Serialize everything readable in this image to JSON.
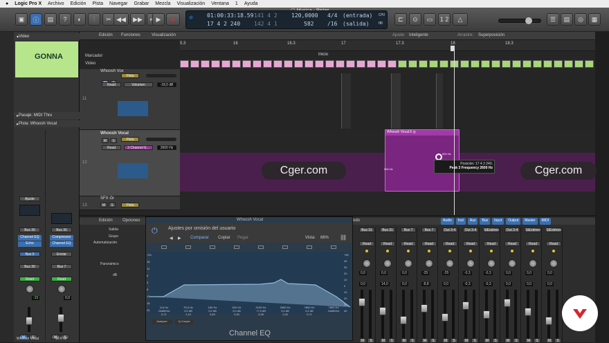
{
  "menubar": {
    "apple": "",
    "app": "Logic Pro X",
    "items": [
      "Archivo",
      "Edición",
      "Pista",
      "Navegar",
      "Grabar",
      "Mezcla",
      "Visualización",
      "Ventana",
      "1",
      "Ayuda"
    ]
  },
  "window": {
    "title": "Musica - Pistas"
  },
  "lcd": {
    "time": "01:00:33:18.59",
    "bars": "17  4  2  240",
    "pos1": "141  4  2",
    "pos2": "142  4  1",
    "tempo": "120,0000",
    "division": "582",
    "sig": "4/4",
    "div2": "/16",
    "in": "(entrada)",
    "out": "(salida)",
    "cpu": "CPU",
    "hd": "HD"
  },
  "inspector": {
    "video": "Video",
    "pasaje": "Pasaje: MIDI Thru",
    "pista": "Pista: Whoosh Vocal",
    "clip_text": "GONNA",
    "ajuste": "Ajuste",
    "bus30": "Bus 30",
    "bus30b": "Bus 30",
    "plugin1": "Channel EQ",
    "plugin1b": "Echo",
    "plugin2": "Compressor",
    "plugin2b": "Channel EQ",
    "bus9": "Bus 9",
    "enviar": "Enviar",
    "bus30c": "Bus 30",
    "bus7": "Bus 7",
    "read1": "Read",
    "read2": "Read",
    "val1": "-15",
    "val2": "0,0",
    "m": "M",
    "s": "S",
    "name1": "Whoosh Vocal",
    "name2": "SFX Gr"
  },
  "arrange": {
    "menu": [
      "Edición",
      "Funciones",
      "Visualización"
    ],
    "ajuste_label": "Ajuste:",
    "ajuste_val": "Inteligente",
    "arrastre_label": "Arrastre:",
    "arrastre_val": "Superposición",
    "marcador": "Marcador",
    "video": "Video",
    "inicio": "Inicio",
    "ruler": [
      "5.3",
      "16",
      "16.3",
      "17",
      "17.3",
      "18",
      "18.3"
    ]
  },
  "tracks": [
    {
      "num": "11",
      "name": "Whoosh Vox",
      "read": "Read",
      "param": "Volumen",
      "val": "-18,0 dB",
      "pista": "Pista"
    },
    {
      "num": "12",
      "name": "Whoosh Vocal",
      "read": "Read",
      "param": "3 Channel E...",
      "val": "2600 Hz",
      "pista": "Pista"
    },
    {
      "num": "13",
      "name": "SFX Gr",
      "pista": "Pista"
    }
  ],
  "region": {
    "name": "Whoosh Vocal.5",
    "hz1": "900 Hz",
    "hz2": "900 Hz",
    "tip1": "Posición: 17 4 2 240.",
    "tip2": "Peak 3 Frequency 2600 Hz"
  },
  "watermark": {
    "left": "Cger.com",
    "right": "Cger.com"
  },
  "mixer": {
    "edicion": "Edición",
    "opciones": "Opciones",
    "labels": [
      "Salida",
      "Grupo",
      "Automatización",
      "Panorámico",
      "dB"
    ],
    "filters": [
      "Audio",
      "Inst",
      "Aux",
      "Bus",
      "Input",
      "Output",
      "Master",
      "MIDI"
    ],
    "todo": "Todo",
    "buses": [
      "Bus 31",
      "Bus 31",
      "Bus 7",
      "Bus 7",
      "Out 3-4",
      "Out 3-4",
      "StEstéreo",
      "Out 3-4",
      "StEstéreo",
      "StEstéreo"
    ],
    "dbs": [
      "0,0",
      "14,0",
      "0,0",
      "-8,8",
      "0,0",
      "-0,3",
      "-0,3",
      "0,0",
      "0,0",
      "0,0"
    ],
    "pans": [
      "0,0",
      "0,0",
      "0,0",
      "-25",
      "-25",
      "-0,3",
      "-0,3",
      "0,0",
      "0,0",
      "0,0"
    ],
    "read": "Read"
  },
  "eq": {
    "title": "Whoosh Vocal",
    "preset": "Ajustes por omisión del usuario",
    "comparar": "Comparar",
    "copiar": "Copiar",
    "pegar": "Pegar",
    "vista_label": "Vista:",
    "vista_val": "66%",
    "name": "Channel EQ",
    "analyzer": "Analyzer",
    "qcouple": "Q-Couple",
    "bands": [
      "114 Hz",
      "75,0 Hz",
      "180 Hz",
      "520 Hz",
      "2100 Hz",
      "2600 Hz",
      "7800 Hz",
      "7800 Hz"
    ],
    "gains": [
      "24dB/Oct",
      "0,0 dB",
      "0,0 dB",
      "0,0 dB",
      "+7,0 dB",
      "0,0 dB",
      "0,0 dB",
      "24dB/Oct"
    ],
    "qs": [
      "0,71",
      "1,10",
      "0,60",
      "0,30",
      "0,98",
      "1,00",
      "0,71",
      ""
    ],
    "scale": [
      "+24",
      "18",
      "12",
      "6",
      "0",
      "6",
      "12",
      "18",
      "24"
    ],
    "scale_right": [
      "+50",
      "40",
      "30",
      "20",
      "10",
      "0",
      "10",
      "20",
      "30",
      "40"
    ]
  },
  "colors": {
    "accent": "#2a7de1",
    "region_purple": "#7a2580",
    "midi_pink": "#e8a6d4",
    "midi_green": "#a8d67a",
    "read_green": "#3cb043",
    "eq_curve": "#9ec9e8"
  }
}
